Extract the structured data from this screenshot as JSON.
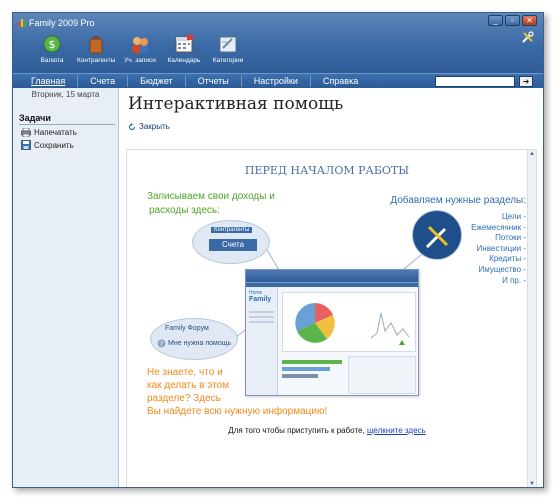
{
  "window": {
    "title": "Family 2009 Pro"
  },
  "toolbar": {
    "items": [
      {
        "label": "Валюта",
        "icon": "currency-icon"
      },
      {
        "label": "Контрагенты",
        "icon": "contacts-icon"
      },
      {
        "label": "Уч. записи",
        "icon": "accounts-icon"
      },
      {
        "label": "Календарь",
        "icon": "calendar-icon"
      },
      {
        "label": "Категории",
        "icon": "categories-icon"
      }
    ]
  },
  "menu": {
    "items": [
      {
        "label": "Главная",
        "active": true
      },
      {
        "label": "Счета"
      },
      {
        "label": "Бюджет"
      },
      {
        "label": "Отчеты"
      },
      {
        "label": "Настройки"
      },
      {
        "label": "Справка"
      }
    ]
  },
  "sidebar": {
    "date": "Вторник, 15 марта",
    "tasks_title": "Задачи",
    "tasks": [
      {
        "label": "Напечатать",
        "icon": "print-icon"
      },
      {
        "label": "Сохранить",
        "icon": "save-icon"
      }
    ]
  },
  "main": {
    "title": "Интерактивная помощь",
    "close_label": "Закрыть",
    "help": {
      "heading": "ПЕРЕД НАЧАЛОМ РАБОТЫ",
      "income_line1": "Записываем свои доходы и",
      "income_line2": "расходы здесь:",
      "sections_title": "Добавляем нужные разделы:",
      "sections": [
        "Цели -",
        "Ежемесячник -",
        "Потоки -",
        "Инвестиции -",
        "Кредиты -",
        "Имущество -",
        "И пр. -"
      ],
      "bubble_tab": "Счета",
      "bubble_top": "Контрагенты",
      "forum_label": "Family Форум",
      "help_label": "Мне нужна помощь",
      "info_line1": "Не знаете, что и",
      "info_line2": "как делать в этом",
      "info_line3": "разделе? Здесь",
      "info_line4": "Вы найдете всю нужную информацию!",
      "start_text": "Для того чтобы приступить к работе,",
      "start_link": "щелкните здесь",
      "mock_logo_top": "Home",
      "mock_logo": "Family"
    }
  },
  "colors": {
    "titlebar": "#3a6aa5",
    "green": "#4fa52b",
    "blue_text": "#2d6fb3",
    "orange": "#f08a1c",
    "link": "#1a3fb5"
  }
}
